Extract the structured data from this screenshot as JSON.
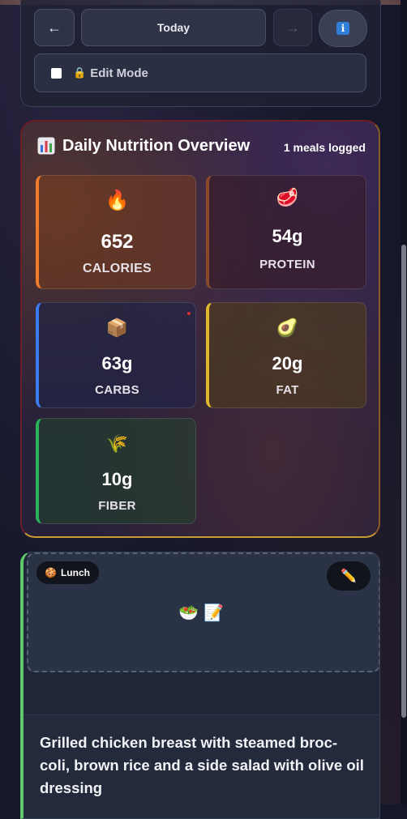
{
  "nav": {
    "prev_icon": "←",
    "today_label": "Today",
    "next_icon": "→",
    "info_icon": "i"
  },
  "edit_mode": {
    "icon": "🔒",
    "label": "Edit Mode",
    "checked": false
  },
  "overview": {
    "title_icon": "bar-chart-icon",
    "title": "Daily Nutrition Overview",
    "meals_logged": "1 meals logged",
    "stats": {
      "calories": {
        "icon": "🔥",
        "value": "652",
        "label": "CALORIES",
        "accent": "#f07b2a"
      },
      "protein": {
        "icon": "🥩",
        "value": "54g",
        "label": "PROTEIN",
        "accent": "#8a4a2a"
      },
      "carbs": {
        "icon": "📦",
        "value": "63g",
        "label": "CARBS",
        "accent": "#3b7bf0"
      },
      "fat": {
        "icon": "🥑",
        "value": "20g",
        "label": "FAT",
        "accent": "#e0b62a"
      },
      "fiber": {
        "icon": "🌾",
        "value": "10g",
        "label": "FIBER",
        "accent": "#2ab35a"
      }
    }
  },
  "meal": {
    "tag_icon": "🍪",
    "tag": "Lunch",
    "edit_icon": "✏️",
    "placeholder_icons": "🥗📝",
    "description": "Grilled chicken breast with steamed broc-coli, brown rice and a side salad with olive oil dressing",
    "accent": "#5ec86a"
  }
}
